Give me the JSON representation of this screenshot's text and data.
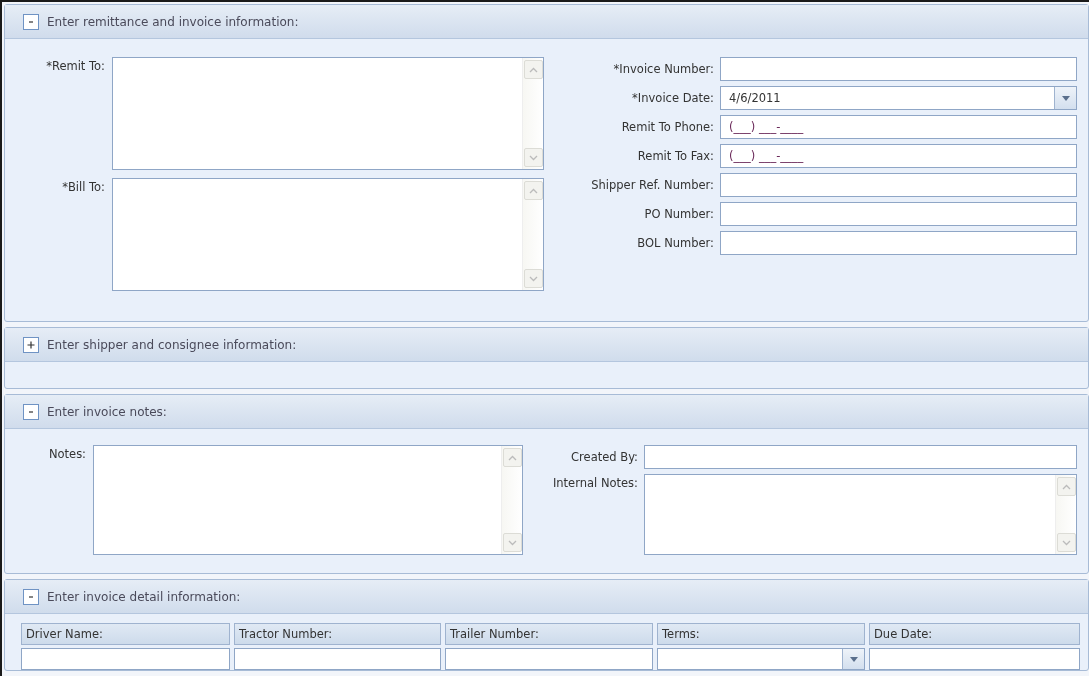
{
  "sections": [
    {
      "kind": "remittance",
      "title": "Enter remittance and invoice information:",
      "expanded": true,
      "left_fields": [
        {
          "label": "*Remit To:",
          "kind": "textarea"
        },
        {
          "label": "*Bill To:",
          "kind": "textarea"
        }
      ],
      "right_fields": [
        {
          "label": "*Invoice Number:",
          "kind": "text"
        },
        {
          "label": "*Invoice Date:",
          "kind": "date",
          "value": "4/6/2011"
        },
        {
          "label": "Remit To Phone:",
          "kind": "masked",
          "value": "(___) ___-____"
        },
        {
          "label": "Remit To Fax:",
          "kind": "masked",
          "value": "(___) ___-____"
        },
        {
          "label": "Shipper Ref. Number:",
          "kind": "text"
        },
        {
          "label": "PO Number:",
          "kind": "text"
        },
        {
          "label": "BOL Number:",
          "kind": "text"
        }
      ]
    },
    {
      "kind": "empty",
      "title": "Enter shipper and consignee information:",
      "expanded": false
    },
    {
      "kind": "notes",
      "title": "Enter invoice notes:",
      "expanded": true,
      "left_fields": [
        {
          "label": "Notes:",
          "kind": "textarea"
        }
      ],
      "right_fields": [
        {
          "label": "Created By:",
          "kind": "text"
        },
        {
          "label": "Internal Notes:",
          "kind": "textarea"
        }
      ]
    },
    {
      "kind": "detail",
      "title": "Enter invoice detail information:",
      "expanded": true,
      "columns": [
        {
          "label": "Driver Name:",
          "kind": "text"
        },
        {
          "label": "Tractor Number:",
          "kind": "text"
        },
        {
          "label": "Trailer Number:",
          "kind": "text"
        },
        {
          "label": "Terms:",
          "kind": "dropdown"
        },
        {
          "label": "Due Date:",
          "kind": "text"
        }
      ]
    }
  ]
}
